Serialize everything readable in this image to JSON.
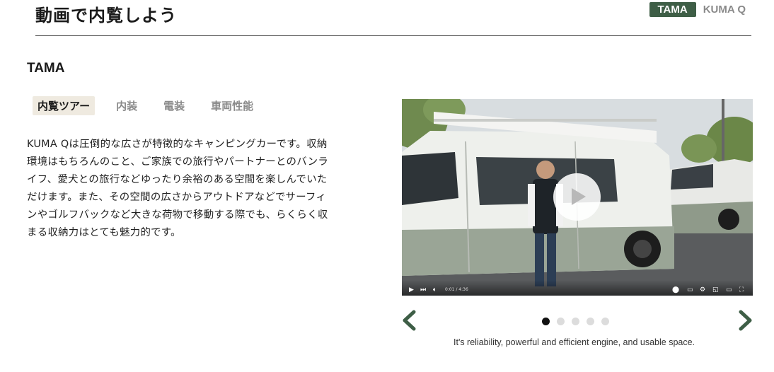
{
  "header": {
    "title": "動画で内覧しよう",
    "models": [
      {
        "label": "TAMA",
        "active": true
      },
      {
        "label": "KUMA Q",
        "active": false
      }
    ]
  },
  "section": {
    "title": "TAMA",
    "tabs": [
      {
        "label": "内覧ツアー",
        "active": true
      },
      {
        "label": "内装",
        "active": false
      },
      {
        "label": "電装",
        "active": false
      },
      {
        "label": "車両性能",
        "active": false
      }
    ],
    "description": "KUMA Qは圧倒的な広さが特徴的なキャンピングカーです。収納環境はもちろんのこと、ご家族での旅行やパートナーとのバンライフ、愛犬との旅行などゆったり余裕のある空間を楽しんでいただけます。また、その空間の広さからアウトドアなどでサーフィンやゴルフバックなど大きな荷物で移動する際でも、らくらく収まる収納力はとても魅力的です。"
  },
  "video": {
    "time": "0:01 / 4:36",
    "progress": 0.004
  },
  "carousel": {
    "slide_count": 5,
    "active_index": 0,
    "caption": "It's reliability, powerful and efficient engine, and usable space."
  },
  "colors": {
    "accent": "#3e5e46",
    "tab_active_bg": "#efeae0",
    "dot_active": "#111111",
    "dot_inactive": "#dcdcdc"
  }
}
